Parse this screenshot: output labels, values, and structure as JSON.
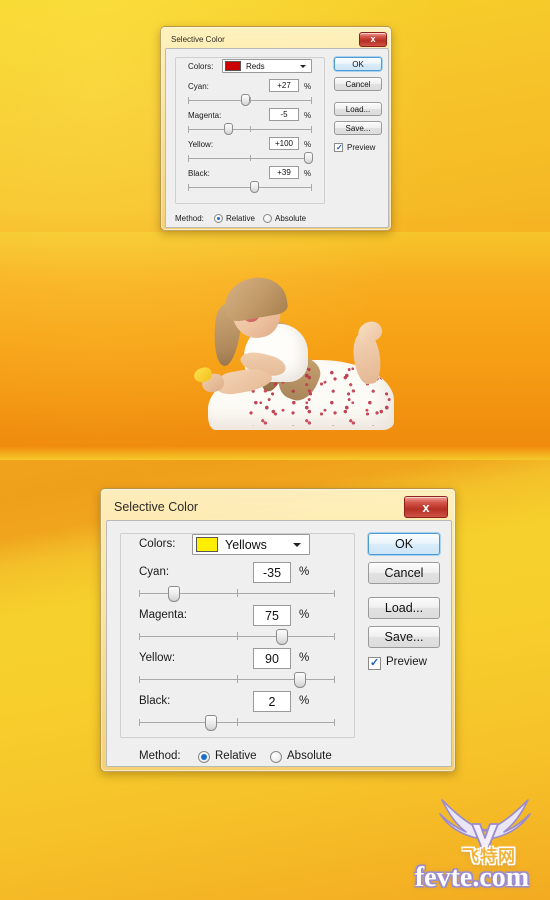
{
  "background": {
    "top_color": "#f7d528",
    "band_color": "#f29312",
    "bottom_color": "#f4c128"
  },
  "photo": {
    "alt": "young girl lying down smiling looking upward"
  },
  "dialogs": [
    {
      "id": "top",
      "title": "Selective Color",
      "close_label": "x",
      "colors_label": "Colors:",
      "colors_value": "Reds",
      "swatch_color": "#cc0000",
      "sliders": [
        {
          "label": "Cyan:",
          "value": "+27",
          "unit": "%",
          "pos": 63
        },
        {
          "label": "Magenta:",
          "value": "-5",
          "unit": "%",
          "pos": 47
        },
        {
          "label": "Yellow:",
          "value": "+100",
          "unit": "%",
          "pos": 100
        },
        {
          "label": "Black:",
          "value": "+39",
          "unit": "%",
          "pos": 69
        }
      ],
      "buttons": [
        {
          "name": "ok",
          "label": "OK",
          "default": true
        },
        {
          "name": "cancel",
          "label": "Cancel",
          "default": false
        },
        {
          "name": "load",
          "label": "Load...",
          "default": false
        },
        {
          "name": "save",
          "label": "Save...",
          "default": false
        }
      ],
      "preview_label": "Preview",
      "preview_checked": true,
      "method_label": "Method:",
      "method_options": [
        {
          "label": "Relative",
          "selected": true
        },
        {
          "label": "Absolute",
          "selected": false
        }
      ]
    },
    {
      "id": "bottom",
      "title": "Selective Color",
      "close_label": "x",
      "colors_label": "Colors:",
      "colors_value": "Yellows",
      "swatch_color": "#ffee00",
      "sliders": [
        {
          "label": "Cyan:",
          "value": "-35",
          "unit": "%",
          "pos": 32
        },
        {
          "label": "Magenta:",
          "value": "75",
          "unit": "%",
          "pos": 87
        },
        {
          "label": "Yellow:",
          "value": "90",
          "unit": "%",
          "pos": 95
        },
        {
          "label": "Black:",
          "value": "2",
          "unit": "%",
          "pos": 51
        }
      ],
      "buttons": [
        {
          "name": "ok",
          "label": "OK",
          "default": true
        },
        {
          "name": "cancel",
          "label": "Cancel",
          "default": false
        },
        {
          "name": "load",
          "label": "Load...",
          "default": false
        },
        {
          "name": "save",
          "label": "Save...",
          "default": false
        }
      ],
      "preview_label": "Preview",
      "preview_checked": true,
      "method_label": "Method:",
      "method_options": [
        {
          "label": "Relative",
          "selected": true
        },
        {
          "label": "Absolute",
          "selected": false
        }
      ]
    }
  ],
  "watermark": {
    "cn_text": "飞特网",
    "domain_text": "fevte.com",
    "logo_letter": "V",
    "wing_color": "#e8e4f7",
    "outline_color": "#9a8ccd"
  }
}
